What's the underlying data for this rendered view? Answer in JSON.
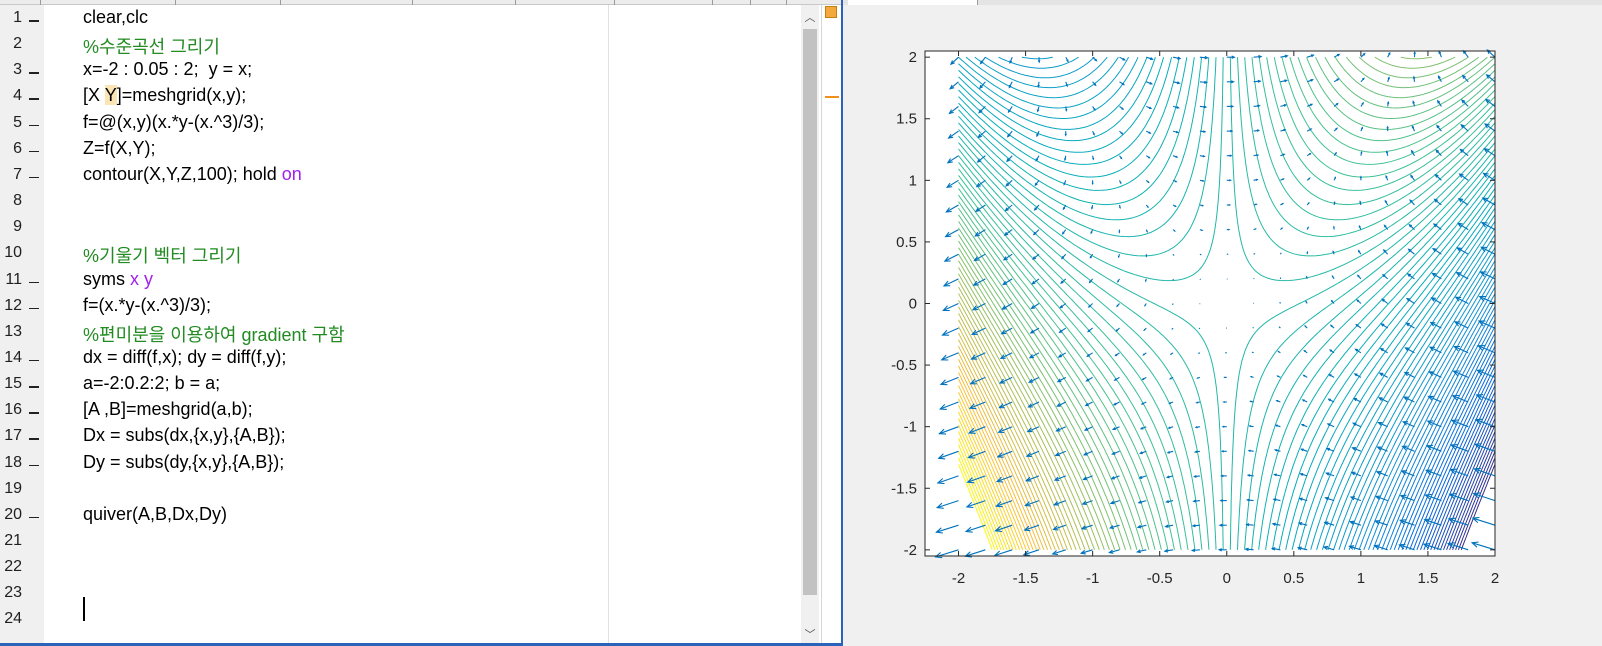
{
  "editor": {
    "lines": [
      {
        "n": "1",
        "dash": true,
        "segs": [
          {
            "t": "clear,clc",
            "c": ""
          }
        ]
      },
      {
        "n": "2",
        "dash": false,
        "segs": [
          {
            "t": "%수준곡선 그리기",
            "c": "cm"
          }
        ]
      },
      {
        "n": "3",
        "dash": true,
        "segs": [
          {
            "t": "x=-2 : 0.05 : 2;  y = x;",
            "c": ""
          }
        ]
      },
      {
        "n": "4",
        "dash": true,
        "segs": [
          {
            "t": "[X ",
            "c": ""
          },
          {
            "t": "Y",
            "c": "hl"
          },
          {
            "t": "]=meshgrid(x,y);",
            "c": ""
          }
        ]
      },
      {
        "n": "5",
        "dash": true,
        "segs": [
          {
            "t": "f=@(x,y)(x.*y-(x.^3)/3);",
            "c": ""
          }
        ]
      },
      {
        "n": "6",
        "dash": true,
        "segs": [
          {
            "t": "Z=f(X,Y);",
            "c": ""
          }
        ]
      },
      {
        "n": "7",
        "dash": true,
        "segs": [
          {
            "t": "contour(X,Y,Z,100); hold ",
            "c": ""
          },
          {
            "t": "on",
            "c": "kw"
          }
        ]
      },
      {
        "n": "8",
        "dash": false,
        "segs": []
      },
      {
        "n": "9",
        "dash": false,
        "segs": []
      },
      {
        "n": "10",
        "dash": false,
        "segs": [
          {
            "t": "%기울기 벡터 그리기",
            "c": "cm"
          }
        ]
      },
      {
        "n": "11",
        "dash": true,
        "segs": [
          {
            "t": "syms ",
            "c": ""
          },
          {
            "t": "x y",
            "c": "kw"
          }
        ]
      },
      {
        "n": "12",
        "dash": true,
        "segs": [
          {
            "t": "f=(x.*y-(x.^3)/3);",
            "c": ""
          }
        ]
      },
      {
        "n": "13",
        "dash": false,
        "segs": [
          {
            "t": "%편미분을 이용하여 gradient 구함",
            "c": "cm"
          }
        ]
      },
      {
        "n": "14",
        "dash": true,
        "segs": [
          {
            "t": "dx = diff(f,x); dy = diff(f,y);",
            "c": ""
          }
        ]
      },
      {
        "n": "15",
        "dash": true,
        "segs": [
          {
            "t": "a=-2:0.2:2; b = a;",
            "c": ""
          }
        ]
      },
      {
        "n": "16",
        "dash": true,
        "segs": [
          {
            "t": "[A ,B]=meshgrid(a,b);",
            "c": ""
          }
        ]
      },
      {
        "n": "17",
        "dash": true,
        "segs": [
          {
            "t": "Dx = subs(dx,{x,y},{A,B});",
            "c": ""
          }
        ]
      },
      {
        "n": "18",
        "dash": true,
        "segs": [
          {
            "t": "Dy = subs(dy,{x,y},{A,B});",
            "c": ""
          }
        ]
      },
      {
        "n": "19",
        "dash": false,
        "segs": []
      },
      {
        "n": "20",
        "dash": true,
        "segs": [
          {
            "t": "quiver(A,B,Dx,Dy)",
            "c": ""
          }
        ]
      },
      {
        "n": "21",
        "dash": false,
        "segs": []
      },
      {
        "n": "22",
        "dash": false,
        "segs": []
      },
      {
        "n": "23",
        "dash": false,
        "segs": []
      },
      {
        "n": "24",
        "dash": false,
        "segs": []
      }
    ],
    "scroll_up_glyph": "︿",
    "scroll_down_glyph": "﹀"
  },
  "colors": {
    "comment": "#228b22",
    "keyword": "#a020f0",
    "quiver": "#0072bd",
    "editor_border": "#2b63b8"
  },
  "chart_data": {
    "type": "contour",
    "function": "f(x,y) = x*y - x^3/3",
    "contour_levels": 100,
    "xlim": [
      -2.25,
      2
    ],
    "ylim": [
      -2.05,
      2.05
    ],
    "xticks": [
      -2,
      -1.5,
      -1,
      -0.5,
      0,
      0.5,
      1,
      1.5,
      2
    ],
    "xtick_labels": [
      "-2",
      "-1.5",
      "-1",
      "-0.5",
      "0",
      "0.5",
      "1",
      "1.5",
      "2"
    ],
    "yticks": [
      2,
      1.5,
      1,
      0.5,
      0,
      -0.5,
      -1,
      -1.5,
      -2
    ],
    "ytick_labels": [
      "2",
      "1.5",
      "1",
      "0.5",
      "0",
      "-0.5",
      "-1",
      "-1.5",
      "-2"
    ],
    "colormap": "parula",
    "quiver": {
      "grid_start": -2,
      "grid_step": 0.2,
      "grid_end": 2,
      "dx": "y - x^2",
      "dy": "x",
      "color": "#0072bd"
    }
  }
}
